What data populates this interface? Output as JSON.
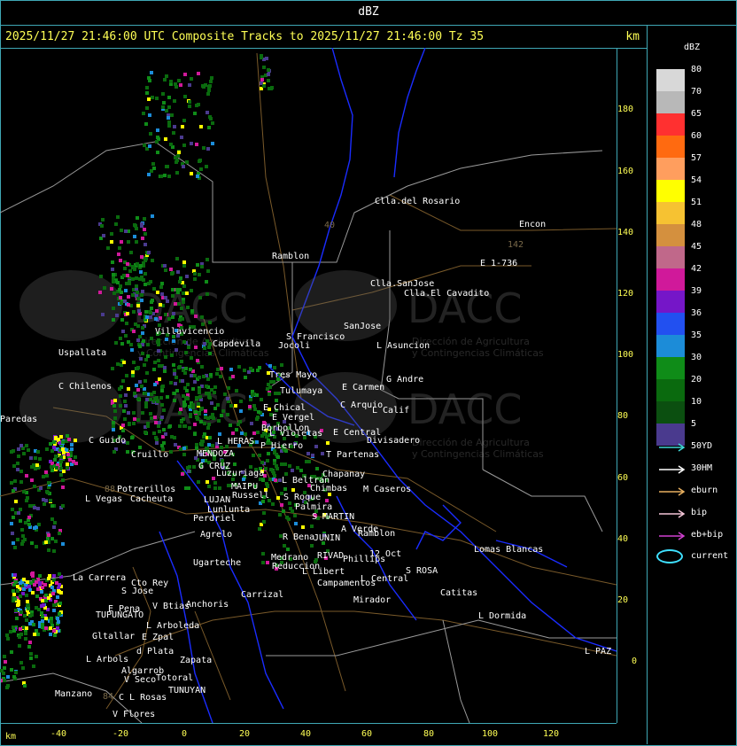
{
  "window": {
    "title": "dBZ"
  },
  "header": {
    "caption": "2025/11/27 21:46:00 UTC Composite Tracks to 2025/11/27 21:46:00 Tz 35",
    "unit": "km"
  },
  "axes": {
    "x_label": "km",
    "x_ticks": [
      "-40",
      "-20",
      "0",
      "20",
      "40",
      "60",
      "80",
      "100",
      "120"
    ],
    "y_ticks": [
      "180",
      "160",
      "140",
      "120",
      "100",
      "80",
      "60",
      "40",
      "20",
      "0"
    ]
  },
  "legend": {
    "title": "dBZ",
    "scale": [
      {
        "label": "80",
        "color": "#d8d8d8"
      },
      {
        "label": "70",
        "color": "#b8b8b8"
      },
      {
        "label": "65",
        "color": "#ff3030"
      },
      {
        "label": "60",
        "color": "#ff6a10"
      },
      {
        "label": "57",
        "color": "#ff9e5e"
      },
      {
        "label": "54",
        "color": "#ffff00"
      },
      {
        "label": "51",
        "color": "#f6c232"
      },
      {
        "label": "48",
        "color": "#d4903e"
      },
      {
        "label": "45",
        "color": "#c0688a"
      },
      {
        "label": "42",
        "color": "#d0199a"
      },
      {
        "label": "39",
        "color": "#7516c8"
      },
      {
        "label": "36",
        "color": "#2250f0"
      },
      {
        "label": "35",
        "color": "#1c8cd8"
      },
      {
        "label": "30",
        "color": "#0f8c18"
      },
      {
        "label": "20",
        "color": "#0a6a0e"
      },
      {
        "label": "10",
        "color": "#0b4f10"
      },
      {
        "label": "5",
        "color": "#4a3a8e"
      }
    ],
    "tracks": [
      {
        "label": "50YD",
        "color": "#3fd6d6"
      },
      {
        "label": "30HM",
        "color": "#ffffff"
      },
      {
        "label": "eburn",
        "color": "#e8b060"
      },
      {
        "label": "bip",
        "color": "#f4c6d8"
      },
      {
        "label": "eb+bip",
        "color": "#d040d0"
      }
    ],
    "current": {
      "label": "current",
      "color": "#3fe0ff"
    }
  },
  "places": [
    "Clla.del Rosario",
    "Encon",
    "142",
    "E 1-736",
    "Ramblon",
    "Clla.SanJose",
    "Clla.El Cavadito",
    "Uspallata",
    "Villavicencio",
    "Capdevila",
    "S Francisco",
    "Jocoli",
    "SanJose",
    "L Asuncion",
    "C Chilenos",
    "Tres Mayo",
    "Tulumaya",
    "E Carmen",
    "G Andre",
    "E Chical",
    "E Vergel",
    "C Arquio",
    "L Calif",
    "Borbollon",
    "L Violetas",
    "E Central",
    "Divisadero",
    "C Guido",
    "L HERAS",
    "P Hierro",
    "MENDOZA",
    "T Partenas",
    "Cruillo",
    "G CRUZ",
    "Luzuriaga",
    "Chapanay",
    "Potrerillos",
    "Russell",
    "L Beltran",
    "MAIPU",
    "M Caseros",
    "L Vegas",
    "Cacheuta",
    "LUJAN",
    "Lunlunta",
    "Chimbas",
    "S Roque",
    "Palmira",
    "Perdriel",
    "S MARTIN",
    "A Verde",
    "Ramblon",
    "Agrelo",
    "R Bena",
    "JUNIN",
    "Lomas Blancas",
    "Ugarteche",
    "Medrano",
    "RIVAD",
    "Phillips",
    "12 Oct",
    "Reduccion",
    "S ROSA",
    "La Carrera",
    "Cto Rey",
    "S Jose",
    "L Libert",
    "Campamentos",
    "L Central",
    "Catitas",
    "E Pena",
    "V Btias",
    "Anchoris",
    "Carrizal",
    "TUPUNGATO",
    "Mirador",
    "L Arboleda",
    "L Dormida",
    "Gltallar",
    "E Zpal",
    "d Plata",
    "L Arbols",
    "Zapata",
    "Algarrob",
    "Totoral",
    "V Seco",
    "TUNUYAN",
    "Manzano",
    "C L Rosas",
    "V Flores",
    "L PAZ",
    "Paredas",
    "88",
    "84",
    "40"
  ],
  "watermark": {
    "brand": "DACC",
    "line1": "Dirección de Agricultura",
    "line2": "y Contingencias Climáticas"
  }
}
